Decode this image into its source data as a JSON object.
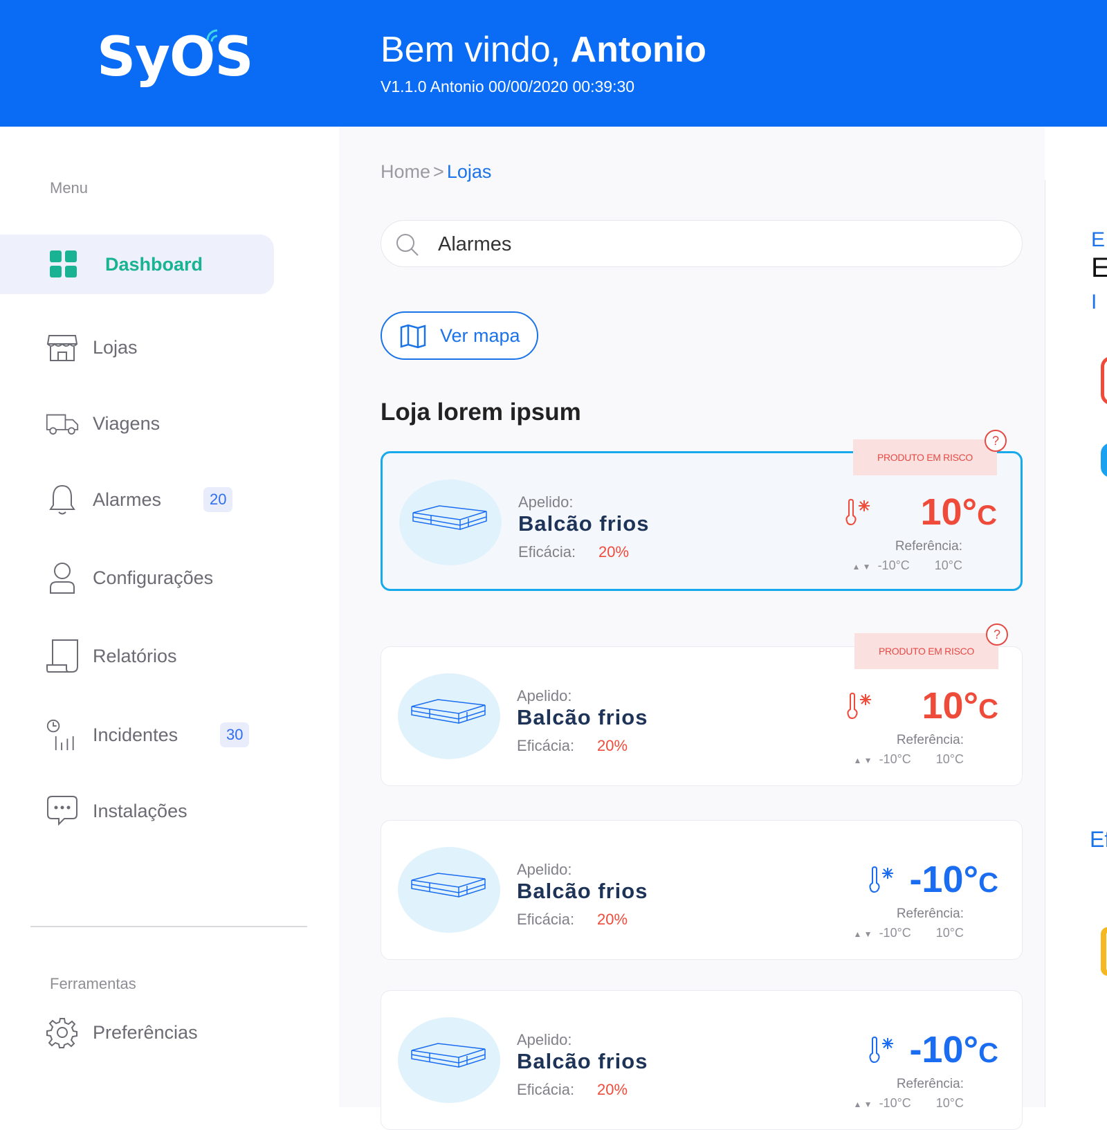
{
  "header": {
    "logo": "SyOS",
    "welcome_prefix": "Bem vindo, ",
    "user_name": "Antonio",
    "subinfo": "V1.1.0 Antonio 00/00/2020 00:39:30"
  },
  "sidebar": {
    "menu_label": "Menu",
    "items": [
      {
        "label": "Dashboard",
        "icon": "grid-icon"
      },
      {
        "label": "Lojas",
        "icon": "store-icon"
      },
      {
        "label": "Viagens",
        "icon": "truck-icon"
      },
      {
        "label": "Alarmes",
        "icon": "bell-icon",
        "badge": "20"
      },
      {
        "label": "Configurações",
        "icon": "user-icon"
      },
      {
        "label": "Relatórios",
        "icon": "report-icon"
      },
      {
        "label": "Incidentes",
        "icon": "chart-clock-icon",
        "badge": "30"
      },
      {
        "label": "Instalações",
        "icon": "chat-icon"
      }
    ],
    "tools_label": "Ferramentas",
    "tools": [
      {
        "label": "Preferências",
        "icon": "gear-icon"
      }
    ]
  },
  "main": {
    "breadcrumb": {
      "home": "Home",
      "separator": ">",
      "current": "Lojas"
    },
    "search": {
      "value": "Alarmes"
    },
    "map_button": "Ver mapa",
    "store_title": "Loja lorem ipsum",
    "cards": [
      {
        "nick_label": "Apelido:",
        "nick": "Balcão frios",
        "eff_label": "Eficácia:",
        "eff": "20%",
        "risk": "PRODUTO EM RISCO",
        "help": "?",
        "temp": "10°",
        "unit": "C",
        "status": "hot",
        "ref_label": "Referência:",
        "ref_min": "-10°C",
        "ref_max": "10°C"
      },
      {
        "nick_label": "Apelido:",
        "nick": "Balcão frios",
        "eff_label": "Eficácia:",
        "eff": "20%",
        "risk": "PRODUTO EM RISCO",
        "help": "?",
        "temp": "10°",
        "unit": "C",
        "status": "hot",
        "ref_label": "Referência:",
        "ref_min": "-10°C",
        "ref_max": "10°C"
      },
      {
        "nick_label": "Apelido:",
        "nick": "Balcão frios",
        "eff_label": "Eficácia:",
        "eff": "20%",
        "risk": "",
        "help": "",
        "temp": "-10°",
        "unit": "C",
        "status": "cold",
        "ref_label": "Referência:",
        "ref_min": "-10°C",
        "ref_max": "10°C"
      },
      {
        "nick_label": "Apelido:",
        "nick": "Balcão frios",
        "eff_label": "Eficácia:",
        "eff": "20%",
        "risk": "",
        "help": "",
        "temp": "-10°",
        "unit": "C",
        "status": "cold",
        "ref_label": "Referência:",
        "ref_min": "-10°C",
        "ref_max": "10°C"
      }
    ]
  },
  "right_panel": {
    "line1": "E",
    "line2": "E",
    "line3": "I",
    "ef_label": "Ef"
  },
  "colors": {
    "primary": "#0a6cf5",
    "accent_green": "#19b394",
    "alert_red": "#ef4b3a",
    "cold_blue": "#1a6cf0"
  }
}
